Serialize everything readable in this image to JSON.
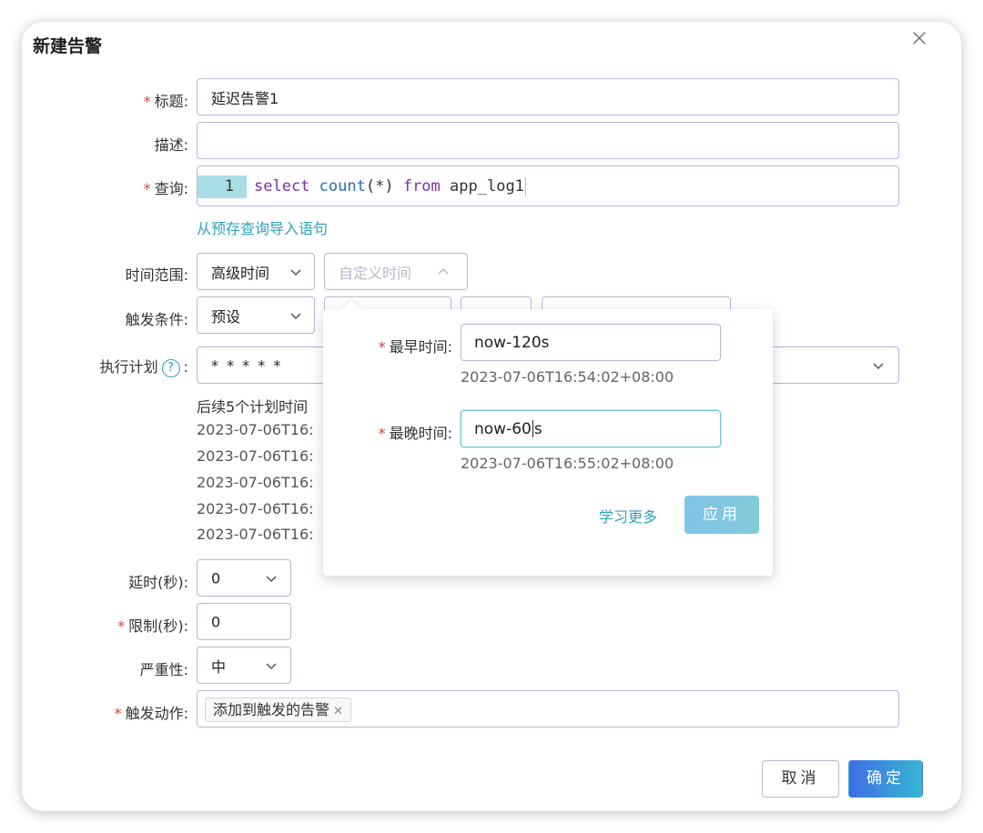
{
  "dialog": {
    "title": "新建告警",
    "close": "×"
  },
  "form": {
    "title_label": "标题",
    "title_value": "延迟告警1",
    "desc_label": "描述",
    "desc_value": "",
    "query_label": "查询",
    "query_line_no": "1",
    "query_tokens": {
      "select": "select",
      "count": "count",
      "paren": "(*)",
      "from": "from",
      "table": "app_log1"
    },
    "import_link": "从预存查询导入语句",
    "time_range_label": "时间范围",
    "time_mode": "高级时间",
    "time_custom": "自定义时间",
    "trigger_label": "触发条件",
    "trigger_value": "预设",
    "schedule_label": "执行计划",
    "schedule_help": "?",
    "schedule_value": "* * * * *",
    "next_runs_title": "后续5个计划时间",
    "next_runs": [
      "2023-07-06T16:",
      "2023-07-06T16:",
      "2023-07-06T16:",
      "2023-07-06T16:",
      "2023-07-06T16:"
    ],
    "delay_label": "延时(秒)",
    "delay_value": "0",
    "limit_label": "限制(秒)",
    "limit_value": "0",
    "severity_label": "严重性",
    "severity_value": "中",
    "action_label": "触发动作",
    "action_tag": "添加到触发的告警",
    "colon": ":"
  },
  "popover": {
    "earliest_label": "最早时间",
    "earliest_value": "now-120s",
    "earliest_resolved": "2023-07-06T16:54:02+08:00",
    "latest_label": "最晚时间",
    "latest_value_before_caret": "now-60",
    "latest_value_after_caret": "s",
    "latest_resolved": "2023-07-06T16:55:02+08:00",
    "learn_more": "学习更多",
    "apply": "应用"
  },
  "footer": {
    "cancel": "取消",
    "ok": "确定"
  },
  "colors": {
    "accent": "#2fa3b8",
    "border": "#b9b5da",
    "required": "#e53935",
    "primary_start": "#3f6ee6",
    "primary_end": "#36b7d0"
  }
}
